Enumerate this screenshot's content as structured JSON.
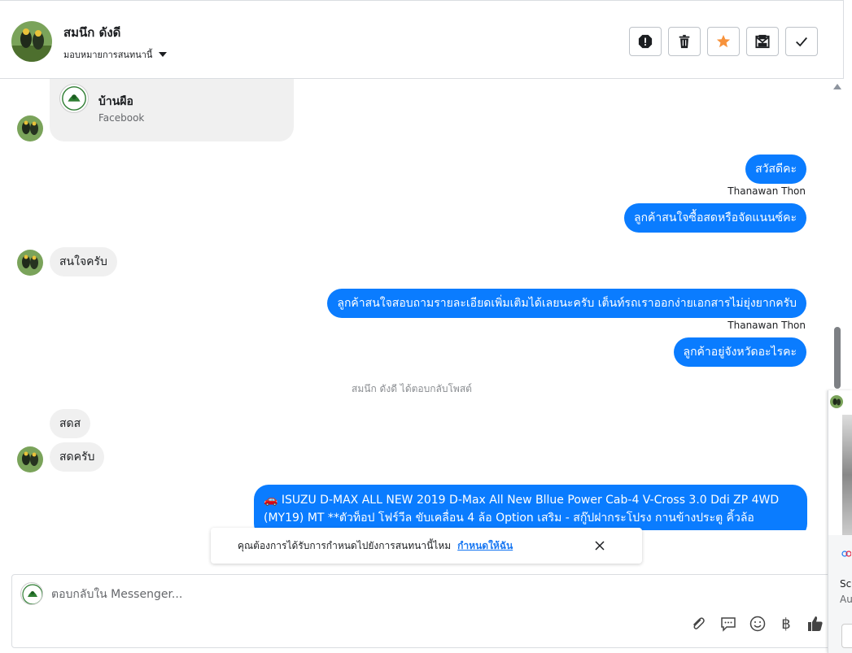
{
  "header": {
    "contact_name": "สมนึก ดังดี",
    "assign_label": "มอบหมายการสนทนานี้",
    "actions": [
      "spam-icon",
      "trash-icon",
      "star-icon",
      "mark-unread-icon",
      "done-icon"
    ]
  },
  "thread": {
    "link_card": {
      "title": "บ้านผือ",
      "source": "Facebook"
    },
    "messages": [
      {
        "dir": "out",
        "text": "สวัสดีคะ"
      },
      {
        "dir": "out",
        "sender": "Thanawan Thon"
      },
      {
        "dir": "out",
        "text": "ลูกค้าสนใจซื้อสดหรือจัดแนนซ์คะ"
      },
      {
        "dir": "in",
        "text": "สนใจครับ"
      },
      {
        "dir": "out",
        "text": "ลูกค้าสนใจสอบถามรายละเอียดเพิ่มเติมได้เลยนะครับ เต็นท์รถเราออกง่ายเอกสารไม่ยุ่งยากครับ"
      },
      {
        "dir": "out",
        "sender": "Thanawan Thon"
      },
      {
        "dir": "out",
        "text": "ลูกค้าอยู่จังหวัดอะไรคะ"
      },
      {
        "dir": "system",
        "text": "สมนึก ดังดี ได้ตอบกลับโพสต์"
      },
      {
        "dir": "in",
        "text": "สดส"
      },
      {
        "dir": "in",
        "text": "สดครับ"
      },
      {
        "dir": "out",
        "text": "🚗 ISUZU D-MAX ALL NEW 2019 D-Max All New Bllue Power Cab-4 V-Cross 3.0 Ddi ZP 4WD (MY19) MT **ตัวท็อป โฟร์วีล ขับเคลื่อน 4 ล้อ Option เสริม - สกู๊ปฝากระโปรง กานข้างประตู คิ้วล้อ"
      }
    ]
  },
  "toast": {
    "text": "คุณต้องการได้รับการกำหนดไปยังการสนทนานี้ไหม",
    "link": "กำหนดให้ฉัน"
  },
  "composer": {
    "placeholder": "ตอบกลับใน Messenger...",
    "tools": [
      "attach-icon",
      "saved-reply-icon",
      "emoji-icon",
      "baht-icon",
      "like-icon"
    ],
    "baht_symbol": "฿"
  },
  "right_panel": {
    "text1": "Sc",
    "text2": "Au"
  },
  "colors": {
    "outgoing_bubble": "#0a7cff",
    "incoming_bubble": "#f0f0f0",
    "star": "#f7923b",
    "link": "#1877f2"
  }
}
